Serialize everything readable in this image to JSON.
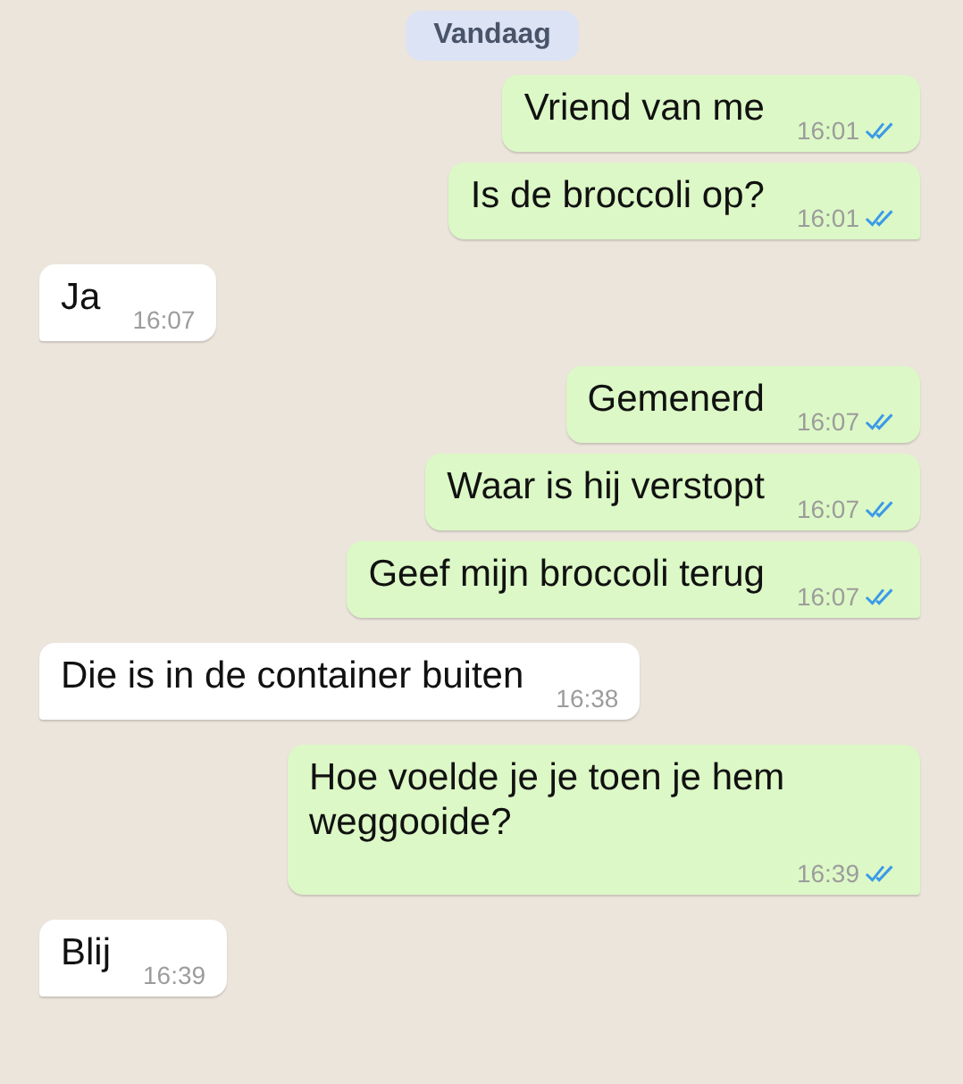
{
  "date_label": "Vandaag",
  "messages": [
    {
      "kind": "sent",
      "text": "Vriend van me",
      "time": "16:01",
      "read": true
    },
    {
      "kind": "sent",
      "text": "Is de broccoli op?",
      "time": "16:01",
      "read": true
    },
    {
      "kind": "received",
      "text": "Ja",
      "time": "16:07"
    },
    {
      "kind": "sent",
      "text": "Gemenerd",
      "time": "16:07",
      "read": true
    },
    {
      "kind": "sent",
      "text": "Waar is hij verstopt",
      "time": "16:07",
      "read": true
    },
    {
      "kind": "sent",
      "text": "Geef mijn broccoli terug",
      "time": "16:07",
      "read": true
    },
    {
      "kind": "received",
      "text": "Die is in de container buiten",
      "time": "16:38"
    },
    {
      "kind": "sent",
      "text": "Hoe voelde je je toen je hem weggooide?",
      "time": "16:39",
      "read": true
    },
    {
      "kind": "received",
      "text": "Blij",
      "time": "16:39"
    }
  ]
}
